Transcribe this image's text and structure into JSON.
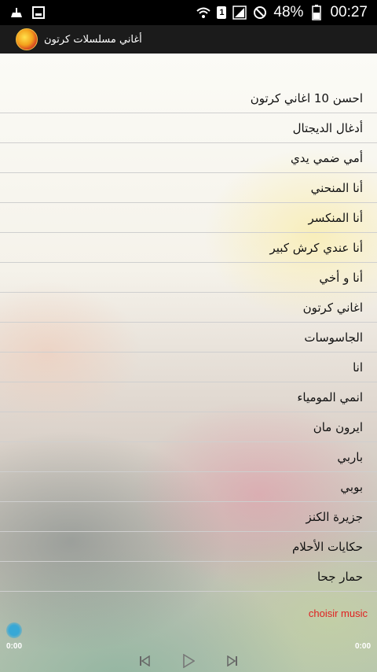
{
  "status_bar": {
    "battery_percent": "48%",
    "time": "00:27",
    "sim_label": "1",
    "icons": [
      "cleaner-icon",
      "gallery-icon",
      "wifi-icon",
      "signal-icon",
      "no-disturb-icon",
      "battery-icon"
    ]
  },
  "app_bar": {
    "title": "أغاني مسلسلات كرتون",
    "logo": "app-logo"
  },
  "songs": [
    "احسن 10 اغاني كرتون",
    "أدغال الديجتال",
    "أمي ضمي يدي",
    "أنا المنحني",
    "أنا المنكسر",
    "أنا عندي كرش كبير",
    "أنا و أخي",
    "اغاني كرتون",
    "الجاسوسات",
    "انا",
    "انمي المومياء",
    "ايرون مان",
    "باربي",
    "بوبي",
    "جزيرة الكنز",
    "حكايات الأحلام",
    "حمار جحا"
  ],
  "choisir_label": "choisir music",
  "player": {
    "elapsed": "0:00",
    "duration": "0:00",
    "progress": 0,
    "icons": [
      "previous-icon",
      "play-icon",
      "next-icon"
    ]
  },
  "colors": {
    "accent": "#38a8d6",
    "choisir": "#e02020",
    "app_bar": "#1b1b1b"
  }
}
